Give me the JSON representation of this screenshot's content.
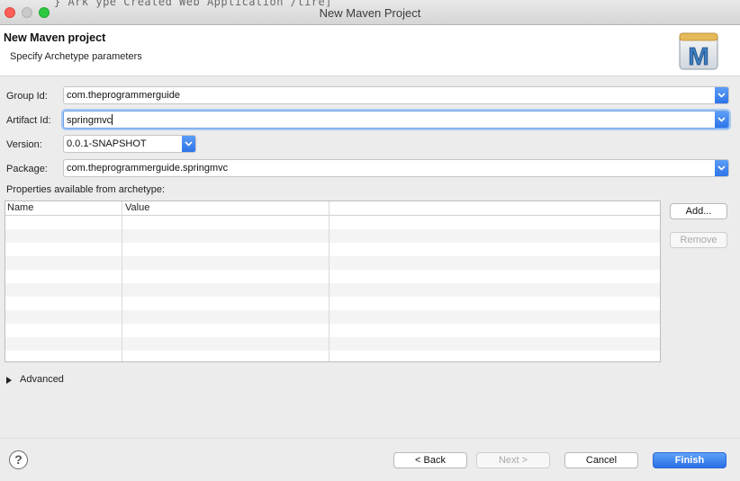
{
  "window": {
    "title": "New Maven Project",
    "background_text": "}   Ark     ype  Created Web Application  /tire]"
  },
  "header": {
    "title": "New Maven project",
    "subtitle": "Specify Archetype parameters",
    "logo_letter": "M"
  },
  "form": {
    "group_id": {
      "label": "Group Id:",
      "value": "com.theprogrammerguide"
    },
    "artifact_id": {
      "label": "Artifact Id:",
      "value": "springmvc"
    },
    "version": {
      "label": "Version:",
      "value": "0.0.1-SNAPSHOT"
    },
    "package": {
      "label": "Package:",
      "value": "com.theprogrammerguide.springmvc"
    }
  },
  "properties": {
    "label": "Properties available from archetype:",
    "columns": [
      "Name",
      "Value"
    ],
    "rows": []
  },
  "side_buttons": {
    "add": "Add...",
    "remove": "Remove"
  },
  "advanced": {
    "label": "Advanced"
  },
  "footer": {
    "help": "?",
    "back": "< Back",
    "next": "Next >",
    "cancel": "Cancel",
    "finish": "Finish"
  },
  "colors": {
    "accent": "#2d74e8",
    "focus_ring": "#a8c9f3",
    "close": "#fd5e57",
    "maximize": "#2ec940"
  }
}
